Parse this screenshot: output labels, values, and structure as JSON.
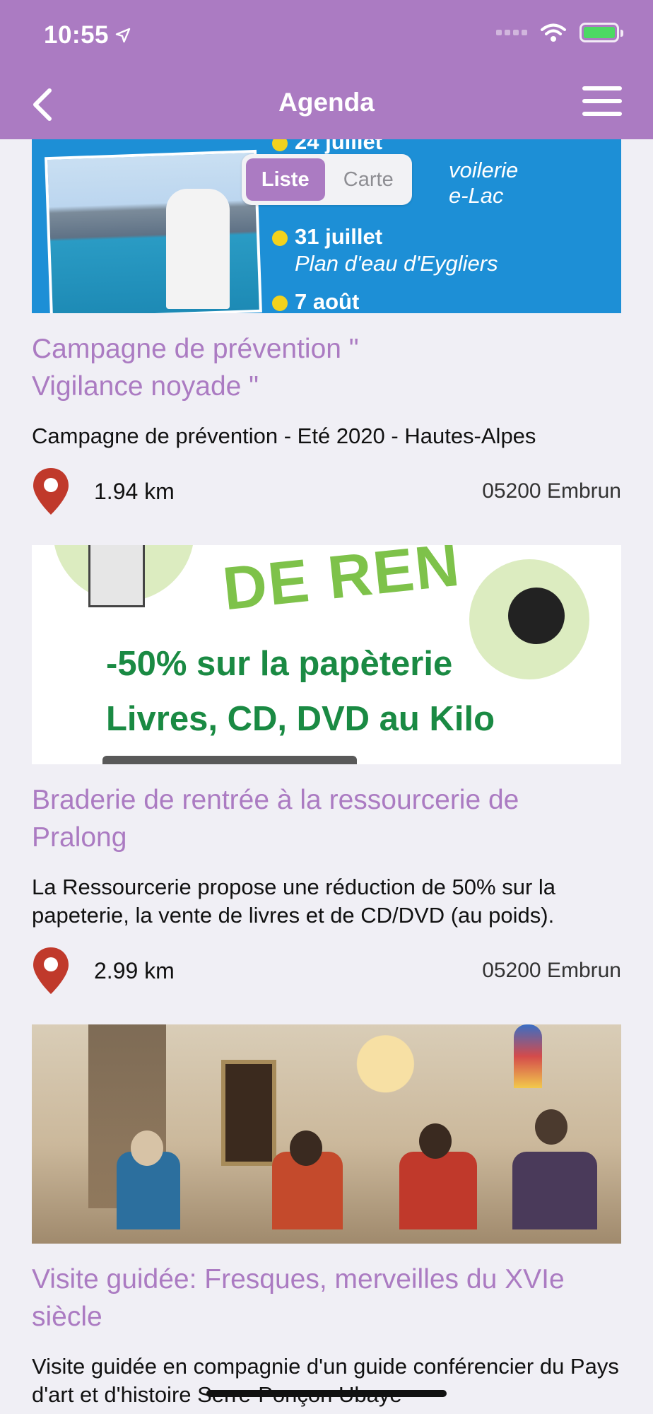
{
  "status_bar": {
    "time": "10:55"
  },
  "header": {
    "title": "Agenda"
  },
  "view_toggle": {
    "options": [
      "Liste",
      "Carte"
    ],
    "selected": "Liste"
  },
  "events": [
    {
      "poster_text": [
        "24 juillet",
        "voilerie",
        "e-Lac",
        "31 juillet",
        "Plan d'eau d'Eygliers",
        "7 août"
      ],
      "title": "Campagne de prévention \" Vigilance noyade \"",
      "description": "Campagne de prévention - Eté 2020 - Hautes-Alpes",
      "distance": "1.94 km",
      "city": "05200 Embrun"
    },
    {
      "poster_text": [
        "DE REN",
        "-50% sur la papèterie",
        "Livres, CD, DVD au Kilo"
      ],
      "title": "Braderie de rentrée à la ressourcerie de Pralong",
      "description": "La Ressourcerie propose une réduction de 50% sur la papeterie, la vente de livres et de CD/DVD (au poids).",
      "distance": "2.99 km",
      "city": "05200 Embrun"
    },
    {
      "title": "Visite guidée: Fresques, merveilles du XVIe siècle",
      "description": "Visite guidée en compagnie d'un guide conférencier du Pays d'art et d'histoire Serre-Ponçon Ubaye"
    }
  ],
  "colors": {
    "accent": "#ab7bc2",
    "pin": "#c0392b",
    "background": "#f0eff5"
  }
}
